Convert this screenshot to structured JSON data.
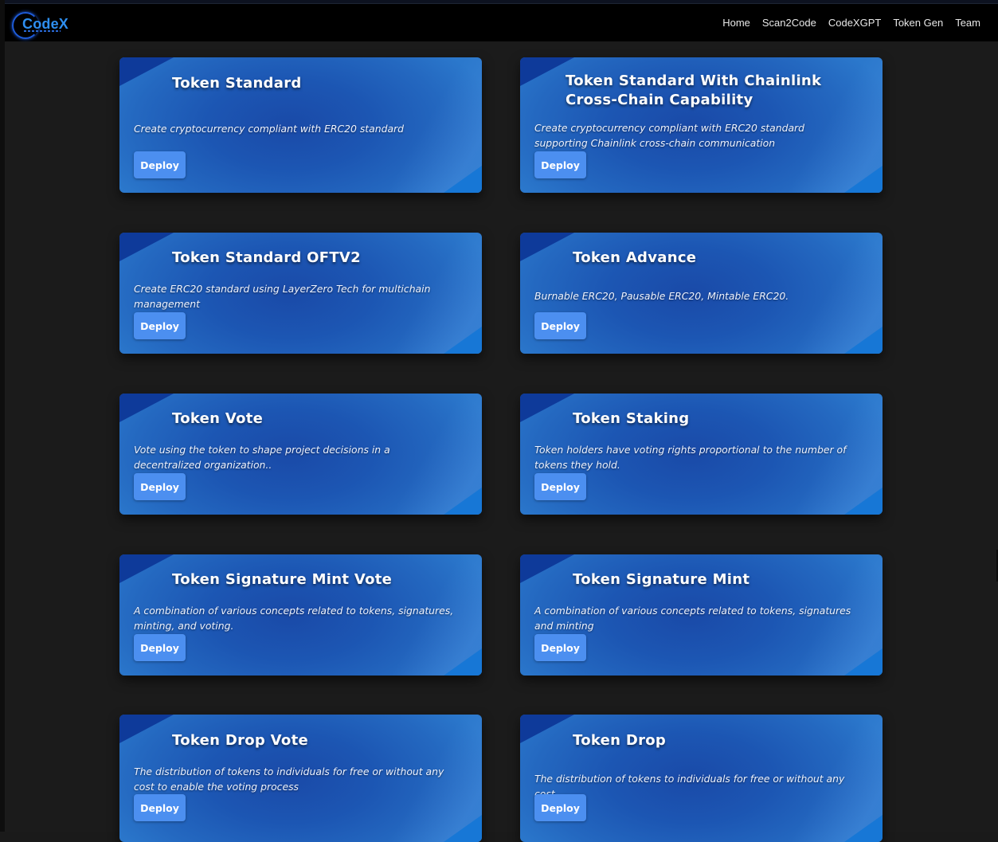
{
  "brand": {
    "logo_text": "CodeX"
  },
  "nav": [
    {
      "label": "Home"
    },
    {
      "label": "Scan2Code"
    },
    {
      "label": "CodeXGPT"
    },
    {
      "label": "Token Gen"
    },
    {
      "label": "Team"
    }
  ],
  "cards": [
    {
      "title": "Token Standard",
      "description": "Create cryptocurrency compliant with ERC20 standard",
      "button": "Deploy"
    },
    {
      "title": "Token Standard With Chainlink Cross-Chain Capability",
      "description": "Create cryptocurrency compliant with ERC20 standard supporting Chainlink cross-chain communication",
      "button": "Deploy"
    },
    {
      "title": "Token Standard OFTV2",
      "description": "Create ERC20 standard using LayerZero Tech for multichain management",
      "button": "Deploy"
    },
    {
      "title": "Token Advance",
      "description": "Burnable ERC20, Pausable ERC20, Mintable ERC20.",
      "button": "Deploy"
    },
    {
      "title": "Token Vote",
      "description": "Vote using the token to shape project decisions in a decentralized organization..",
      "button": "Deploy"
    },
    {
      "title": "Token Staking",
      "description": "Token holders have voting rights proportional to the number of tokens they hold.",
      "button": "Deploy"
    },
    {
      "title": "Token Signature Mint Vote",
      "description": "A combination of various concepts related to tokens, signatures, minting, and voting.",
      "button": "Deploy"
    },
    {
      "title": "Token Signature Mint",
      "description": "A combination of various concepts related to tokens, signatures and minting",
      "button": "Deploy"
    },
    {
      "title": "Token Drop Vote",
      "description": "The distribution of tokens to individuals for free or without any cost to enable the voting process",
      "button": "Deploy"
    },
    {
      "title": "Token Drop",
      "description": "The distribution of tokens to individuals for free or without any cost.",
      "button": "Deploy"
    }
  ]
}
